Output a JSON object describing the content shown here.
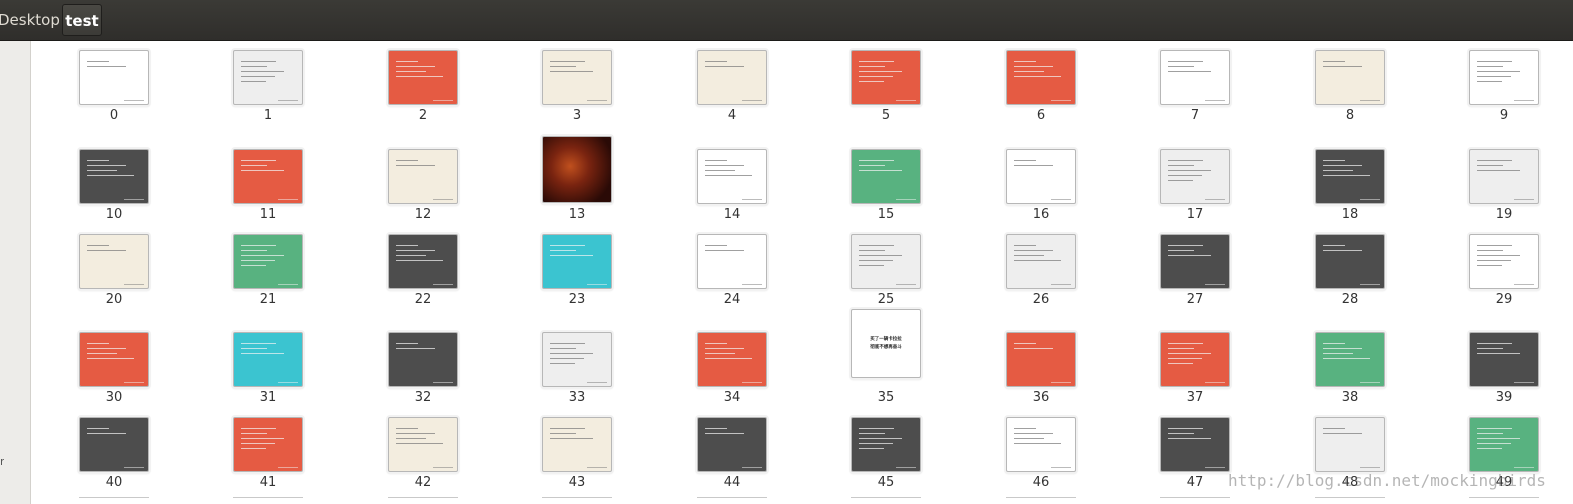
{
  "breadcrumb": {
    "items": [
      "Desktop",
      "test"
    ]
  },
  "sidebar": {
    "visible_fragment": "r"
  },
  "colors": {
    "white": "#ffffff",
    "light_gray": "#eeeeee",
    "red": "#e55b43",
    "cream": "#f3eddf",
    "dark_gray": "#4d4d4d",
    "green": "#58b280",
    "cyan": "#3bc4d0",
    "photo": "#5a1a10"
  },
  "files": [
    {
      "name": "0",
      "style": "white"
    },
    {
      "name": "1",
      "style": "light_gray"
    },
    {
      "name": "2",
      "style": "red"
    },
    {
      "name": "3",
      "style": "cream"
    },
    {
      "name": "4",
      "style": "cream"
    },
    {
      "name": "5",
      "style": "red"
    },
    {
      "name": "6",
      "style": "red"
    },
    {
      "name": "7",
      "style": "white"
    },
    {
      "name": "8",
      "style": "cream"
    },
    {
      "name": "9",
      "style": "white"
    },
    {
      "name": "10",
      "style": "dark_gray"
    },
    {
      "name": "11",
      "style": "red"
    },
    {
      "name": "12",
      "style": "cream"
    },
    {
      "name": "13",
      "style": "photo"
    },
    {
      "name": "14",
      "style": "white"
    },
    {
      "name": "15",
      "style": "green"
    },
    {
      "name": "16",
      "style": "white"
    },
    {
      "name": "17",
      "style": "light_gray"
    },
    {
      "name": "18",
      "style": "dark_gray"
    },
    {
      "name": "19",
      "style": "light_gray"
    },
    {
      "name": "20",
      "style": "cream"
    },
    {
      "name": "21",
      "style": "green"
    },
    {
      "name": "22",
      "style": "dark_gray"
    },
    {
      "name": "23",
      "style": "cyan"
    },
    {
      "name": "24",
      "style": "white"
    },
    {
      "name": "25",
      "style": "light_gray"
    },
    {
      "name": "26",
      "style": "light_gray"
    },
    {
      "name": "27",
      "style": "dark_gray"
    },
    {
      "name": "28",
      "style": "dark_gray"
    },
    {
      "name": "29",
      "style": "white"
    },
    {
      "name": "30",
      "style": "red"
    },
    {
      "name": "31",
      "style": "cyan"
    },
    {
      "name": "32",
      "style": "dark_gray"
    },
    {
      "name": "33",
      "style": "light_gray"
    },
    {
      "name": "34",
      "style": "red"
    },
    {
      "name": "35",
      "style": "white_tall",
      "text": "买了一辆卡拉拉\n彻底不想再奋斗"
    },
    {
      "name": "36",
      "style": "red"
    },
    {
      "name": "37",
      "style": "red"
    },
    {
      "name": "38",
      "style": "green"
    },
    {
      "name": "39",
      "style": "dark_gray"
    },
    {
      "name": "40",
      "style": "dark_gray"
    },
    {
      "name": "41",
      "style": "red"
    },
    {
      "name": "42",
      "style": "cream"
    },
    {
      "name": "43",
      "style": "cream"
    },
    {
      "name": "44",
      "style": "dark_gray"
    },
    {
      "name": "45",
      "style": "dark_gray"
    },
    {
      "name": "46",
      "style": "white"
    },
    {
      "name": "47",
      "style": "dark_gray"
    },
    {
      "name": "48",
      "style": "light_gray"
    },
    {
      "name": "49",
      "style": "green"
    }
  ],
  "watermark": "http://blog.csdn.net/mockingbirds"
}
